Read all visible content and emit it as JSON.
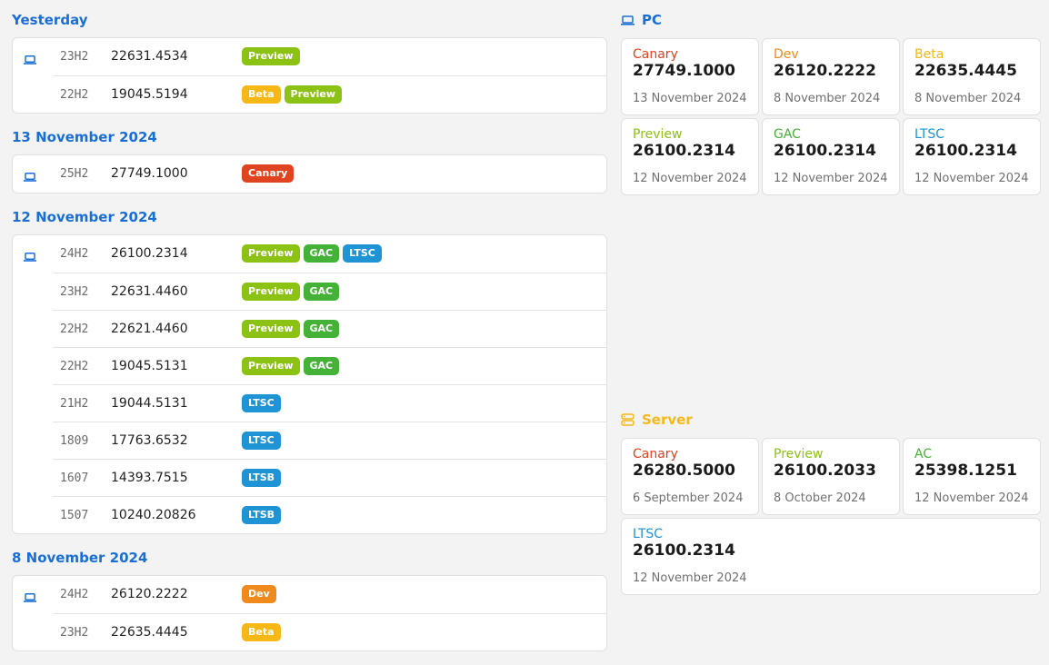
{
  "colors": {
    "Canary": "#e0431f",
    "Dev": "#f08a1c",
    "Beta": "#f6b816",
    "Preview": "#8cc214",
    "GAC": "#44b236",
    "LTSC": "#1e94d4",
    "LTSB": "#1e94d4",
    "AC": "#44b236",
    "accent": "#1a6fd6",
    "server": "#f6b816"
  },
  "groups": [
    {
      "title": "Yesterday",
      "rows": [
        {
          "ver": "23H2",
          "build": "22631.4534",
          "badges": [
            "Preview"
          ]
        },
        {
          "ver": "22H2",
          "build": "19045.5194",
          "badges": [
            "Beta",
            "Preview"
          ]
        }
      ]
    },
    {
      "title": "13 November 2024",
      "rows": [
        {
          "ver": "25H2",
          "build": "27749.1000",
          "badges": [
            "Canary"
          ]
        }
      ]
    },
    {
      "title": "12 November 2024",
      "rows": [
        {
          "ver": "24H2",
          "build": "26100.2314",
          "badges": [
            "Preview",
            "GAC",
            "LTSC"
          ]
        },
        {
          "ver": "23H2",
          "build": "22631.4460",
          "badges": [
            "Preview",
            "GAC"
          ]
        },
        {
          "ver": "22H2",
          "build": "22621.4460",
          "badges": [
            "Preview",
            "GAC"
          ]
        },
        {
          "ver": "22H2",
          "build": "19045.5131",
          "badges": [
            "Preview",
            "GAC"
          ]
        },
        {
          "ver": "21H2",
          "build": "19044.5131",
          "badges": [
            "LTSC"
          ]
        },
        {
          "ver": "1809",
          "build": "17763.6532",
          "badges": [
            "LTSC"
          ]
        },
        {
          "ver": "1607",
          "build": "14393.7515",
          "badges": [
            "LTSB"
          ]
        },
        {
          "ver": "1507",
          "build": "10240.20826",
          "badges": [
            "LTSB"
          ]
        }
      ]
    },
    {
      "title": "8 November 2024",
      "rows": [
        {
          "ver": "24H2",
          "build": "26120.2222",
          "badges": [
            "Dev"
          ]
        },
        {
          "ver": "23H2",
          "build": "22635.4445",
          "badges": [
            "Beta"
          ]
        }
      ]
    }
  ],
  "pc": {
    "title": "PC",
    "icon": "laptop-icon",
    "tiles": [
      {
        "channel": "Canary",
        "build": "27749.1000",
        "date": "13 November 2024"
      },
      {
        "channel": "Dev",
        "build": "26120.2222",
        "date": "8 November 2024"
      },
      {
        "channel": "Beta",
        "build": "22635.4445",
        "date": "8 November 2024"
      },
      {
        "channel": "Preview",
        "build": "26100.2314",
        "date": "12 November 2024"
      },
      {
        "channel": "GAC",
        "build": "26100.2314",
        "date": "12 November 2024"
      },
      {
        "channel": "LTSC",
        "build": "26100.2314",
        "date": "12 November 2024"
      }
    ]
  },
  "server": {
    "title": "Server",
    "icon": "server-icon",
    "tiles": [
      {
        "channel": "Canary",
        "build": "26280.5000",
        "date": "6 September 2024"
      },
      {
        "channel": "Preview",
        "build": "26100.2033",
        "date": "8 October 2024"
      },
      {
        "channel": "AC",
        "build": "25398.1251",
        "date": "12 November 2024"
      },
      {
        "channel": "LTSC",
        "build": "26100.2314",
        "date": "12 November 2024"
      }
    ]
  }
}
